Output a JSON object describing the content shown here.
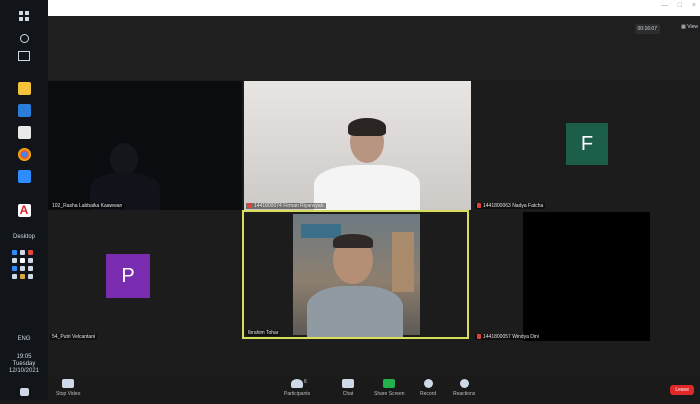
{
  "taskbar": {
    "desktop_label": "Desktop",
    "lang": "ENG",
    "time": "19:05",
    "day": "Tuesday",
    "date": "12/10/2021"
  },
  "zoom": {
    "window_controls": {
      "minimize": "—",
      "maximize": "□",
      "close": "×"
    },
    "timer": "00:16:07",
    "view_label": "View",
    "tiles": [
      {
        "name": "102_Rasha Labbaika Kaawwan",
        "muted": false
      },
      {
        "name": "1441800074 Firman Riyansyah",
        "muted": true
      },
      {
        "name": "1441800063 Nadya Fatcha",
        "muted": true,
        "avatar": "F",
        "avatar_color": "#1d5e4a"
      },
      {
        "name": "54_Putri Velcantani",
        "muted": false,
        "avatar": "P",
        "avatar_color": "#7a2cb0"
      },
      {
        "name": "Ibrahim Tohar",
        "muted": false,
        "active": true
      },
      {
        "name": "1441800057 Windya Dini",
        "muted": true
      }
    ],
    "toolbar": {
      "stop_video": "Stop Video",
      "participants": "Participants",
      "participants_count": "6",
      "chat": "Chat",
      "share_screen": "Share Screen",
      "record": "Record",
      "reactions": "Reactions",
      "leave": "Leave"
    }
  },
  "colors": {
    "active_border": "#d8dd5a",
    "share_green": "#22b14c",
    "leave_red": "#e02828"
  }
}
